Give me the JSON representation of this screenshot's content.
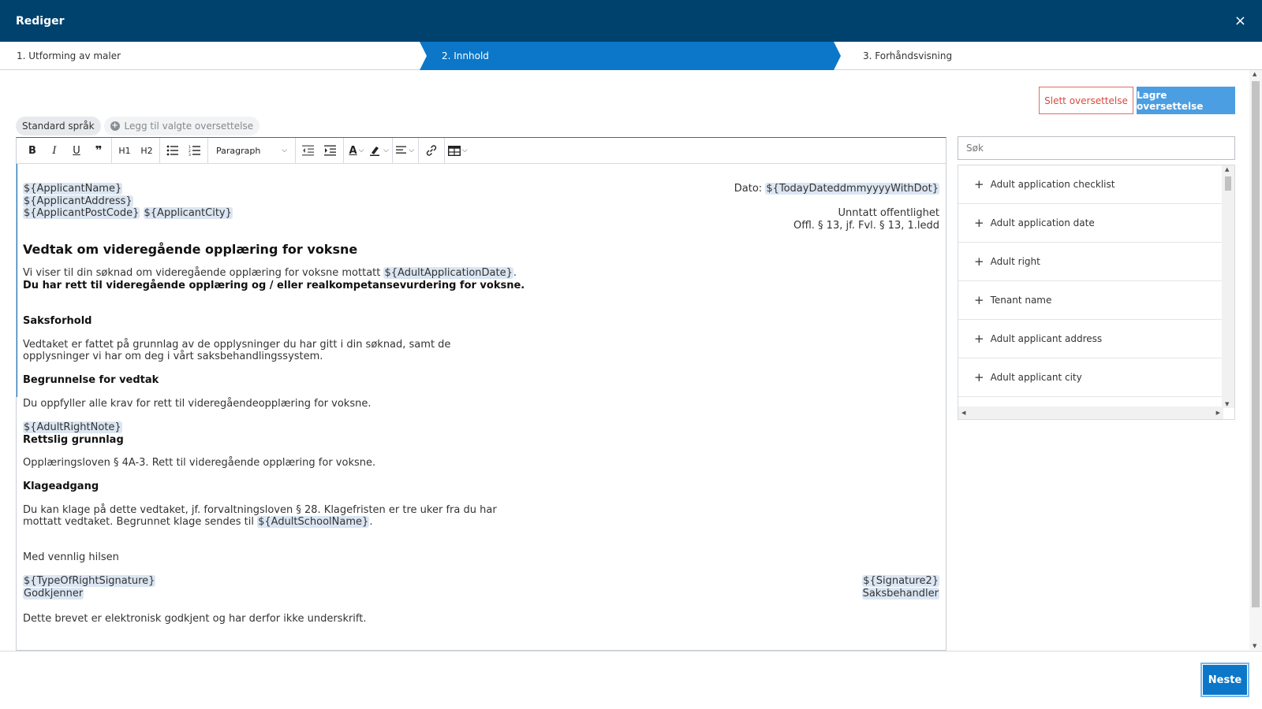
{
  "header": {
    "title": "Rediger",
    "close_glyph": "×"
  },
  "steps": [
    {
      "label": "1. Utforming av maler"
    },
    {
      "label": "2. Innhold"
    },
    {
      "label": "3. Forhåndsvisning"
    }
  ],
  "actions": {
    "delete_label": "Slett oversettelse",
    "save_label": "Lagre oversettelse"
  },
  "languages": {
    "default_label": "Standard språk",
    "add_label": "Legg til valgte oversettelse"
  },
  "toolbar": {
    "bold": "B",
    "italic": "I",
    "underline": "U",
    "quote": "❞",
    "h1": "H1",
    "h2": "H2",
    "paragraph": "Paragraph",
    "font_color": "A"
  },
  "document": {
    "applicant_name": "${ApplicantName}",
    "applicant_address": "${ApplicantAddress}",
    "applicant_postcode": "${ApplicantPostCode}",
    "applicant_city": "${ApplicantCity}",
    "date_label": "Dato: ",
    "date_value": "${TodayDateddmmyyyyWithDot}",
    "exempt_line1": "Unntatt offentlighet",
    "exempt_line2": "Offl. § 13, jf. Fvl. § 13, 1.ledd",
    "title": "Vedtak om videregående opplæring for voksne",
    "intro_text": "Vi viser til din søknad om videregående opplæring for voksne mottatt ",
    "intro_placeholder": "${AdultApplicationDate}",
    "intro_end": ".",
    "intro_bold": "Du har rett til videregående opplæring og / eller realkompetansevurdering for voksne.",
    "case_heading": "Saksforhold",
    "case_line1": "Vedtaket er fattet på grunnlag av de opplysninger du har gitt i din søknad, samt de",
    "case_line2": "opplysninger vi har om deg i vårt saksbehandlingssystem.",
    "reason_heading": "Begrunnelse for vedtak",
    "reason_text": "Du oppfyller alle krav for rett til videregåendeopplæring for voksne.",
    "right_note": "${AdultRightNote}",
    "legal_heading": "Rettslig grunnlag",
    "legal_text": "Opplæringsloven § 4A-3. Rett til videregående opplæring for voksne.",
    "appeal_heading": "Klageadgang",
    "appeal_line1": "Du kan klage på dette vedtaket, jf. forvaltningsloven § 28. Klagefristen er tre uker fra du har",
    "appeal_line2": "mottatt vedtaket. Begrunnet klage sendes til ",
    "appeal_placeholder": "${AdultSchoolName}",
    "appeal_end": ".",
    "greeting": "Med vennlig hilsen",
    "sig1": "${TypeOfRightSignature}",
    "sig1_role": "Godkjenner",
    "sig2": "${Signature2}",
    "sig2_role": "Saksbehandler",
    "footer_note": "Dette brevet er elektronisk godkjent og har derfor ikke underskrift."
  },
  "search": {
    "placeholder": "Søk"
  },
  "variables": [
    "Adult application checklist",
    "Adult application date",
    "Adult right",
    "Tenant name",
    "Adult applicant address",
    "Adult applicant city"
  ],
  "footer": {
    "next_label": "Neste"
  }
}
